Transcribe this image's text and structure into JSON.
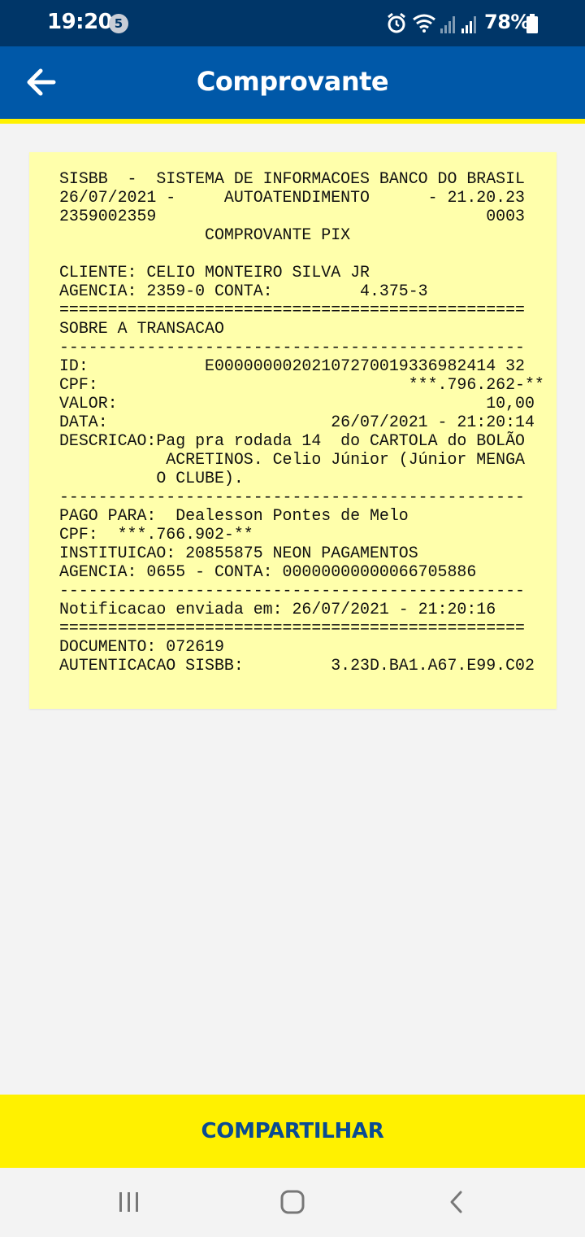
{
  "status_bar": {
    "time": "19:20",
    "notification_count": "5",
    "battery_percent": "78%",
    "icons": [
      "alarm-icon",
      "wifi-icon",
      "signal-icon",
      "signal-icon",
      "battery-icon"
    ]
  },
  "header": {
    "title": "Comprovante",
    "back_icon": "arrow-left-icon"
  },
  "receipt": {
    "lines": [
      "SISBB  -  SISTEMA DE INFORMACOES BANCO DO BRASIL",
      "26/07/2021 -     AUTOATENDIMENTO      - 21.20.23",
      "2359002359                                  0003",
      "               COMPROVANTE PIX",
      "",
      "CLIENTE: CELIO MONTEIRO SILVA JR",
      "AGENCIA: 2359-0 CONTA:         4.375-3",
      "================================================",
      "SOBRE A TRANSACAO",
      "------------------------------------------------",
      "ID:            E00000000202107270019336982414 32",
      "CPF:                                ***.796.262-**",
      "VALOR:                                      10,00",
      "DATA:                       26/07/2021 - 21:20:14",
      "DESCRICAO:Pag pra rodada 14  do CARTOLA do BOLÃO",
      "           ACRETINOS. Celio Júnior (Júnior MENGA",
      "          O CLUBE).",
      "------------------------------------------------",
      "PAGO PARA:  Dealesson Pontes de Melo",
      "CPF:  ***.766.902-**",
      "INSTITUICAO: 20855875 NEON PAGAMENTOS",
      "AGENCIA: 0655 - CONTA: 00000000000066705886",
      "------------------------------------------------",
      "Notificacao enviada em: 26/07/2021 - 21:20:16",
      "================================================",
      "DOCUMENTO: 072619",
      "AUTENTICACAO SISBB:         3.23D.BA1.A67.E99.C02"
    ]
  },
  "actions": {
    "share_label": "COMPARTILHAR"
  },
  "navigation_bar": {
    "icons": [
      "recent-apps-icon",
      "home-icon",
      "back-icon"
    ]
  },
  "colors": {
    "status_bar": "#003668",
    "app_bar": "#0058a8",
    "accent_yellow": "#fff100",
    "receipt_bg": "#ffffab",
    "share_text": "#0a4b92"
  }
}
